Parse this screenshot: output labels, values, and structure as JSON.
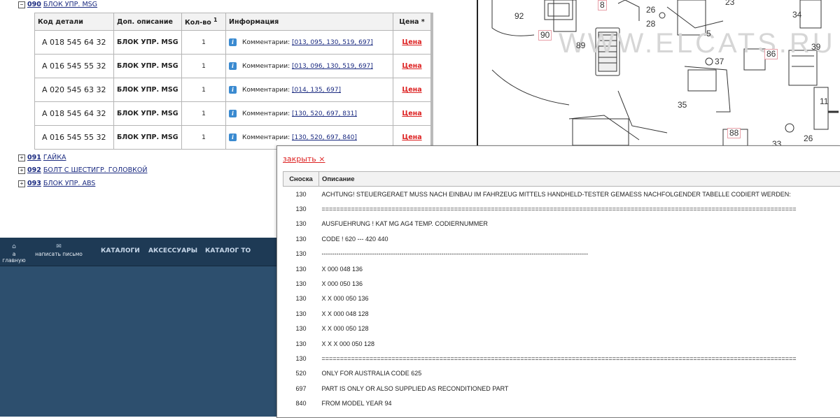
{
  "tree": {
    "expanded_item": {
      "toggle": "−",
      "number": "090",
      "name": "БЛОК УПР. MSG"
    },
    "collapsed_items": [
      {
        "toggle": "+",
        "number": "091",
        "name": "ГАЙКА"
      },
      {
        "toggle": "+",
        "number": "092",
        "name": "БОЛТ С ШЕСТИГР. ГОЛОВКОЙ"
      },
      {
        "toggle": "+",
        "number": "093",
        "name": "БЛОК УПР. ABS"
      }
    ]
  },
  "parts_table": {
    "headers": {
      "code": "Код детали",
      "desc": "Доп. описание",
      "qty": "Кол-во",
      "qty_sup": "1",
      "info": "Информация",
      "price": "Цена *"
    },
    "info_icon": "info-icon",
    "rows": [
      {
        "code": "A 018 545 64 32",
        "desc": "БЛОК УПР. MSG",
        "qty": "1",
        "comment_label": "Комментарии:",
        "comments": "[013, 095, 130, 519, 697]",
        "price": "Цена"
      },
      {
        "code": "A 016 545 55 32",
        "desc": "БЛОК УПР. MSG",
        "qty": "1",
        "comment_label": "Комментарии:",
        "comments": "[013, 096, 130, 519, 697]",
        "price": "Цена"
      },
      {
        "code": "A 020 545 63 32",
        "desc": "БЛОК УПР. MSG",
        "qty": "1",
        "comment_label": "Комментарии:",
        "comments": "[014, 135, 697]",
        "price": "Цена"
      },
      {
        "code": "A 018 545 64 32",
        "desc": "БЛОК УПР. MSG",
        "qty": "1",
        "comment_label": "Комментарии:",
        "comments": "[130, 520, 697, 831]",
        "price": "Цена"
      },
      {
        "code": "A 016 545 55 32",
        "desc": "БЛОК УПР. MSG",
        "qty": "1",
        "comment_label": "Комментарии:",
        "comments": "[130, 520, 697, 840]",
        "price": "Цена"
      }
    ]
  },
  "diagram": {
    "watermark": "WWW.ELCATS.RU",
    "callouts": [
      {
        "label": "92",
        "pink": false
      },
      {
        "label": "90",
        "pink": true
      },
      {
        "label": "8",
        "pink": true
      },
      {
        "label": "26",
        "pink": false
      },
      {
        "label": "28",
        "pink": false
      },
      {
        "label": "23",
        "pink": false
      },
      {
        "label": "5",
        "pink": false
      },
      {
        "label": "34",
        "pink": false
      },
      {
        "label": "89",
        "pink": false
      },
      {
        "label": "37",
        "pink": false
      },
      {
        "label": "86",
        "pink": true
      },
      {
        "label": "39",
        "pink": false
      },
      {
        "label": "11",
        "pink": false
      },
      {
        "label": "35",
        "pink": false
      },
      {
        "label": "88",
        "pink": true
      },
      {
        "label": "26",
        "pink": false
      },
      {
        "label": "33",
        "pink": false
      }
    ]
  },
  "navbar": {
    "icons": [
      {
        "glyph": "home-icon",
        "label": "а главную"
      },
      {
        "glyph": "mail-icon",
        "label": "написать письмо"
      }
    ],
    "links": [
      "КАТАЛОГИ",
      "АКСЕССУАРЫ",
      "КАТАЛОГ ТО"
    ]
  },
  "popup": {
    "close_label": "закрыть ×",
    "headers": {
      "ref": "Сноска",
      "desc": "Описание"
    },
    "rows": [
      {
        "ref": "130",
        "text": "ACHTUNG! STEUERGERAET MUSS NACH EINBAU IM FAHRZEUG MITTELS HANDHELD-TESTER GEMAESS NACHFOLGENDER TABELLE CODIERT WERDEN:"
      },
      {
        "ref": "130",
        "text": "================================================================================================================================="
      },
      {
        "ref": "130",
        "text": "AUSFUEHRUNG ! KAT MG AG4 TEMP. CODIERNUMMER"
      },
      {
        "ref": "130",
        "text": "CODE ! 620 --- 420 440"
      },
      {
        "ref": "130",
        "text": "-------------------------------------------------------------------------------------------------------------------------------"
      },
      {
        "ref": "130",
        "text": "X 000 048 136"
      },
      {
        "ref": "130",
        "text": "X 000 050 136"
      },
      {
        "ref": "130",
        "text": "X X 000 050 136"
      },
      {
        "ref": "130",
        "text": "X X 000 048 128"
      },
      {
        "ref": "130",
        "text": "X X 000 050 128"
      },
      {
        "ref": "130",
        "text": "X X X 000 050 128"
      },
      {
        "ref": "130",
        "text": "================================================================================================================================="
      },
      {
        "ref": "520",
        "text": "ONLY FOR AUSTRALIA CODE 625"
      },
      {
        "ref": "697",
        "text": "PART IS ONLY OR ALSO SUPPLIED AS RECONDITIONED PART"
      },
      {
        "ref": "840",
        "text": "FROM MODEL YEAR 94"
      }
    ]
  }
}
